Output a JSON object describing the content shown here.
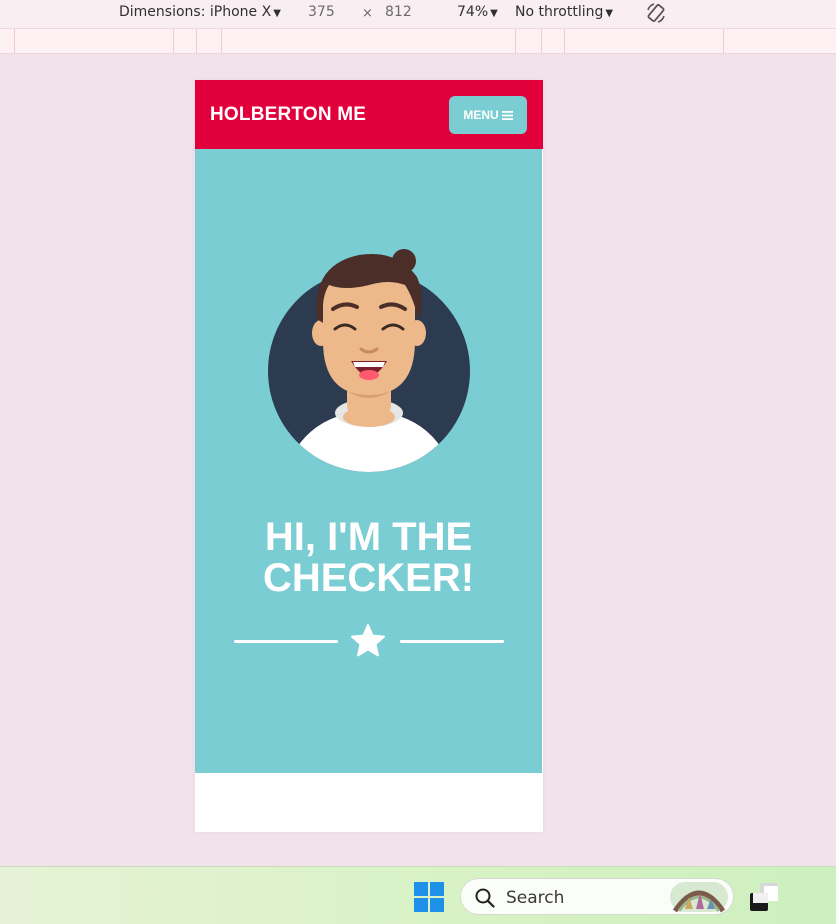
{
  "devtools": {
    "dimensions_label": "Dimensions: iPhone X",
    "width": "375",
    "times": "×",
    "height": "812",
    "zoom": "74%",
    "throttling": "No throttling",
    "caret": "▼"
  },
  "site": {
    "brand": "HOLBERTON ME",
    "menu_label": "MENU",
    "hero_title_line1": "HI, I'M THE",
    "hero_title_line2": "CHECKER!"
  },
  "taskbar": {
    "search_label": "Search"
  },
  "colors": {
    "header_red": "#e1003b",
    "hero_teal": "#7acdd3",
    "page_bg": "#f2e3ea",
    "avatar_circle": "#2d3b50"
  },
  "icons": [
    "rotate-icon",
    "hamburger-icon",
    "star-icon",
    "windows-icon",
    "search-icon",
    "taskview-icon"
  ]
}
